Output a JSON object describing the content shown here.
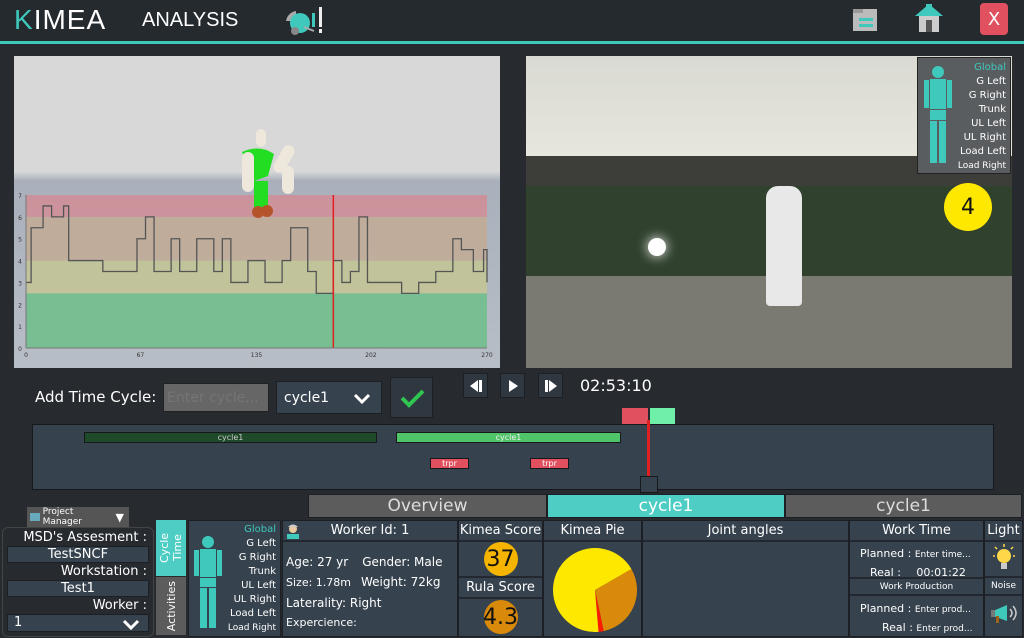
{
  "header": {
    "brand_k": "K",
    "brand_rest": "IMEA",
    "subtitle": "ANALYSIS",
    "icons": [
      "analysis-logo-icon",
      "file-list-icon",
      "home-icon",
      "close-icon"
    ],
    "close_label": "X"
  },
  "chart_data": {
    "type": "line",
    "step": true,
    "xlim": [
      0,
      270
    ],
    "ylim": [
      0,
      7
    ],
    "x_ticks": [
      "0",
      "67",
      "135",
      "202",
      "270"
    ],
    "y_ticks": [
      "0",
      "1",
      "2",
      "3",
      "4",
      "5",
      "6",
      "7"
    ],
    "zones": [
      {
        "from": 0,
        "to": 2.5,
        "color": "#5fbf80"
      },
      {
        "from": 2.5,
        "to": 4,
        "color": "#c8c88a"
      },
      {
        "from": 4,
        "to": 6,
        "color": "#c6a98e"
      },
      {
        "from": 6,
        "to": 7,
        "color": "#d9878f"
      }
    ],
    "cursor_x": 180,
    "x": [
      0,
      3,
      10,
      15,
      22,
      25,
      40,
      45,
      60,
      65,
      70,
      75,
      85,
      90,
      100,
      110,
      115,
      120,
      130,
      140,
      150,
      155,
      165,
      170,
      180,
      185,
      190,
      195,
      200,
      220,
      230,
      240,
      250,
      255,
      262,
      268,
      270
    ],
    "y": [
      3,
      5.5,
      6.5,
      6,
      6.5,
      4,
      4,
      3.5,
      3.5,
      5,
      6,
      3.5,
      5,
      3.5,
      5,
      3.5,
      5,
      3,
      4,
      3,
      4,
      5.5,
      3.5,
      2.5,
      4,
      3,
      3.5,
      6,
      3,
      2.5,
      3,
      3.5,
      5,
      4.5,
      3.5,
      4.5,
      3
    ]
  },
  "video": {
    "body_parts": [
      "Global",
      "G Left",
      "G Right",
      "Trunk",
      "UL Left",
      "UL Right",
      "Load Left",
      "Load Right"
    ],
    "score": "4",
    "score_color": "#ffe800"
  },
  "controls": {
    "add_time_cycle_label": "Add Time Cycle:",
    "cycle_input_placeholder": "Enter cycle...",
    "cycle_select_value": "cycle1",
    "time": "02:53:10"
  },
  "timeline": {
    "cycles": [
      {
        "label": "cycle1",
        "color": "#1f4a2a"
      },
      {
        "label": "cycle1",
        "color": "#4fc468"
      }
    ],
    "activities": [
      {
        "label": "trpr"
      },
      {
        "label": "trpr"
      }
    ]
  },
  "tabs": [
    {
      "label": "Overview",
      "active": false
    },
    {
      "label": "cycle1",
      "active": true
    },
    {
      "label": "cycle1",
      "active": false
    }
  ],
  "project": {
    "manager_label": "Project Manager",
    "msd_label": "MSD's Assesment :",
    "msd_value": "TestSNCF",
    "workstation_label": "Workstation :",
    "workstation_value": "Test1",
    "worker_label": "Worker :",
    "worker_value": "1"
  },
  "side_tabs": [
    "Cycle Time",
    "Activities"
  ],
  "body_parts": [
    "Global",
    "G Left",
    "G Right",
    "Trunk",
    "UL Left",
    "UL Right",
    "Load Left",
    "Load Right"
  ],
  "worker": {
    "title": "Worker Id: 1",
    "age": "Age: 27 yr",
    "gender": "Gender: Male",
    "size": "Size: 1.78m",
    "weight": "Weight: 72kg",
    "laterality": "Laterality: Right",
    "experience": "Expercience:"
  },
  "scores": {
    "kimea_title": "Kimea Score",
    "kimea_value": "37",
    "kimea_color": "#f5b400",
    "rula_title": "Rula Score",
    "rula_value": "4.3",
    "rula_color": "#d98a0a"
  },
  "pie": {
    "title": "Kimea Pie",
    "slices": [
      {
        "value": 0.3,
        "color": "#d98a0a"
      },
      {
        "value": 0.02,
        "color": "#ff1a00"
      },
      {
        "value": 0.68,
        "color": "#ffe800"
      }
    ]
  },
  "joint_angles": {
    "title": "Joint angles"
  },
  "work": {
    "time_title": "Work Time",
    "planned_label": "Planned :",
    "planned_time": "Enter time...",
    "real_label": "Real :",
    "real_time": "00:01:22",
    "production_title": "Work Production",
    "planned_prod": "Enter prod...",
    "real_prod": "Enter prod..."
  },
  "env": {
    "light": "Light",
    "noise": "Noise"
  }
}
